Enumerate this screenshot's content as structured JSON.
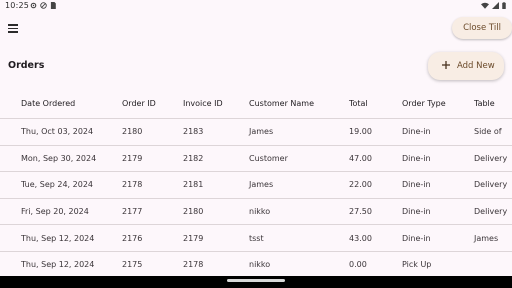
{
  "status_bar": {
    "time": "10:25"
  },
  "toolbar": {
    "close_till_label": "Close Till"
  },
  "page": {
    "title": "Orders",
    "add_new_label": "Add New"
  },
  "table": {
    "columns": [
      "Date Ordered",
      "Order ID",
      "Invoice ID",
      "Customer Name",
      "Total",
      "Order Type",
      "Table"
    ],
    "rows": [
      [
        "Thu, Oct 03, 2024",
        "2180",
        "2183",
        "James",
        "19.00",
        "Dine-in",
        "Side of"
      ],
      [
        "Mon, Sep 30, 2024",
        "2179",
        "2182",
        "Customer",
        "47.00",
        "Dine-in",
        "Delivery"
      ],
      [
        "Tue, Sep 24, 2024",
        "2178",
        "2181",
        "James",
        "22.00",
        "Dine-in",
        "Delivery"
      ],
      [
        "Fri, Sep 20, 2024",
        "2177",
        "2180",
        "nikko",
        "27.50",
        "Dine-in",
        "Delivery"
      ],
      [
        "Thu, Sep 12, 2024",
        "2176",
        "2179",
        "tsst",
        "43.00",
        "Dine-in",
        "James"
      ],
      [
        "Thu, Sep 12, 2024",
        "2175",
        "2178",
        "nikko",
        "0.00",
        "Pick Up",
        ""
      ]
    ]
  },
  "colors": {
    "background": "#fdf7fb",
    "button_bg": "#f8ede4",
    "button_text": "#6b4a2a",
    "divider": "#ddd5d8"
  }
}
